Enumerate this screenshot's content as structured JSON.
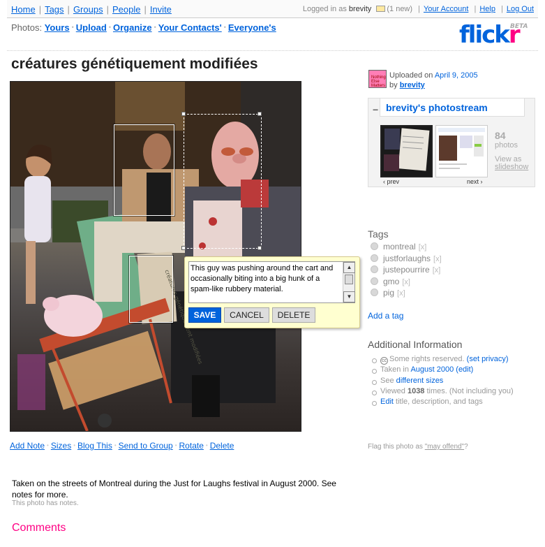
{
  "topnav": {
    "items": [
      "Home",
      "Tags",
      "Groups",
      "People",
      "Invite"
    ],
    "logged_in_as_label": "Logged in as",
    "username": "brevity",
    "new_mail": "(1 new)",
    "your_account": "Your Account",
    "help": "Help",
    "log_out": "Log Out"
  },
  "photosnav": {
    "label": "Photos:",
    "items": [
      "Yours",
      "Upload",
      "Organize",
      "Your Contacts'",
      "Everyone's"
    ]
  },
  "logo": {
    "text_blue": "flick",
    "text_pink": "r",
    "beta": "BETA"
  },
  "photo": {
    "title": "créatures génétiquement modifiées",
    "sign_text": "créatures génétiquement modifiées"
  },
  "note_editor": {
    "text": "This guy was pushing around the cart and occasionally biting into a big hunk of a spam-like rubbery material.",
    "save": "SAVE",
    "cancel": "CANCEL",
    "delete": "DELETE"
  },
  "actions": [
    "Add Note",
    "Sizes",
    "Blog This",
    "Send to Group",
    "Rotate",
    "Delete"
  ],
  "description": "Taken on the streets of Montreal during the Just for Laughs festival in August 2000. See notes for more.",
  "has_notes": "This photo has notes.",
  "comments_heading": "Comments",
  "uploader": {
    "uploaded_on_label": "Uploaded on",
    "date": "April 9, 2005",
    "by_label": "by",
    "user": "brevity",
    "buddy_icon_text": "Nothing Else Matters"
  },
  "photostream": {
    "title": "brevity's photostream",
    "count": "84",
    "count_label": "photos",
    "view_as": "View as",
    "slideshow": "slideshow",
    "prev": "‹ prev",
    "next": "next ›"
  },
  "tags": {
    "heading": "Tags",
    "items": [
      "montreal",
      "justforlaughs",
      "justepourrire",
      "gmo",
      "pig"
    ],
    "remove": "[x]",
    "add_tag": "Add a tag"
  },
  "additional_info": {
    "heading": "Additional Information",
    "rights_text": "Some rights reserved.",
    "set_privacy": "(set privacy)",
    "taken_in_label": "Taken in",
    "taken_in": "August 2000",
    "edit": "(edit)",
    "see_label": "See",
    "different_sizes": "different sizes",
    "viewed_label": "Viewed",
    "viewed_count": "1038",
    "viewed_suffix": "times.  (Not including you)",
    "edit_link": "Edit",
    "edit_suffix": "title, description, and tags"
  },
  "flag": {
    "prefix": "Flag this photo as",
    "link": "\"may offend\"",
    "suffix": "?"
  },
  "colors": {
    "brand_blue": "#0063dc",
    "brand_pink": "#ff0084",
    "note_bg": "#ffffd0"
  }
}
